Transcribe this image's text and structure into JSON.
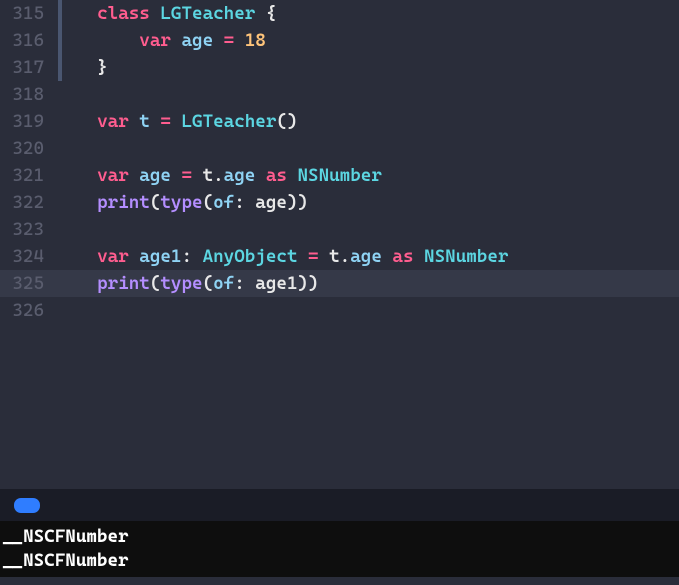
{
  "lines": [
    {
      "num": 315,
      "gutter": true,
      "highlight": false,
      "indent": "  ",
      "tokens": [
        {
          "cls": "kw",
          "t": "class"
        },
        {
          "cls": "punct",
          "t": " "
        },
        {
          "cls": "type",
          "t": "LGTeacher"
        },
        {
          "cls": "punct",
          "t": " {"
        }
      ]
    },
    {
      "num": 316,
      "gutter": true,
      "highlight": false,
      "indent": "      ",
      "tokens": [
        {
          "cls": "kw",
          "t": "var"
        },
        {
          "cls": "punct",
          "t": " "
        },
        {
          "cls": "prop",
          "t": "age"
        },
        {
          "cls": "punct",
          "t": " "
        },
        {
          "cls": "eq",
          "t": "="
        },
        {
          "cls": "punct",
          "t": " "
        },
        {
          "cls": "num",
          "t": "18"
        }
      ]
    },
    {
      "num": 317,
      "gutter": true,
      "highlight": false,
      "indent": "  ",
      "tokens": [
        {
          "cls": "punct",
          "t": "}"
        }
      ]
    },
    {
      "num": 318,
      "gutter": false,
      "highlight": false,
      "indent": "",
      "tokens": []
    },
    {
      "num": 319,
      "gutter": false,
      "highlight": false,
      "indent": "  ",
      "tokens": [
        {
          "cls": "kw",
          "t": "var"
        },
        {
          "cls": "punct",
          "t": " "
        },
        {
          "cls": "prop",
          "t": "t"
        },
        {
          "cls": "punct",
          "t": " "
        },
        {
          "cls": "eq",
          "t": "="
        },
        {
          "cls": "punct",
          "t": " "
        },
        {
          "cls": "type",
          "t": "LGTeacher"
        },
        {
          "cls": "punct",
          "t": "()"
        }
      ]
    },
    {
      "num": 320,
      "gutter": false,
      "highlight": false,
      "indent": "",
      "tokens": []
    },
    {
      "num": 321,
      "gutter": false,
      "highlight": false,
      "indent": "  ",
      "tokens": [
        {
          "cls": "kw",
          "t": "var"
        },
        {
          "cls": "punct",
          "t": " "
        },
        {
          "cls": "prop",
          "t": "age"
        },
        {
          "cls": "punct",
          "t": " "
        },
        {
          "cls": "eq",
          "t": "="
        },
        {
          "cls": "punct",
          "t": " "
        },
        {
          "cls": "var",
          "t": "t"
        },
        {
          "cls": "punct",
          "t": "."
        },
        {
          "cls": "prop",
          "t": "age"
        },
        {
          "cls": "punct",
          "t": " "
        },
        {
          "cls": "kw",
          "t": "as"
        },
        {
          "cls": "punct",
          "t": " "
        },
        {
          "cls": "type",
          "t": "NSNumber"
        }
      ]
    },
    {
      "num": 322,
      "gutter": false,
      "highlight": false,
      "indent": "  ",
      "tokens": [
        {
          "cls": "fn",
          "t": "print"
        },
        {
          "cls": "punct",
          "t": "("
        },
        {
          "cls": "fn",
          "t": "type"
        },
        {
          "cls": "punct",
          "t": "("
        },
        {
          "cls": "param",
          "t": "of"
        },
        {
          "cls": "punct",
          "t": ": "
        },
        {
          "cls": "var",
          "t": "age"
        },
        {
          "cls": "punct",
          "t": "))"
        }
      ]
    },
    {
      "num": 323,
      "gutter": false,
      "highlight": false,
      "indent": "",
      "tokens": []
    },
    {
      "num": 324,
      "gutter": false,
      "highlight": false,
      "indent": "  ",
      "tokens": [
        {
          "cls": "kw",
          "t": "var"
        },
        {
          "cls": "punct",
          "t": " "
        },
        {
          "cls": "prop",
          "t": "age1"
        },
        {
          "cls": "punct",
          "t": ": "
        },
        {
          "cls": "type",
          "t": "AnyObject"
        },
        {
          "cls": "punct",
          "t": " "
        },
        {
          "cls": "eq",
          "t": "="
        },
        {
          "cls": "punct",
          "t": " "
        },
        {
          "cls": "var",
          "t": "t"
        },
        {
          "cls": "punct",
          "t": "."
        },
        {
          "cls": "prop",
          "t": "age"
        },
        {
          "cls": "punct",
          "t": " "
        },
        {
          "cls": "kw",
          "t": "as"
        },
        {
          "cls": "punct",
          "t": " "
        },
        {
          "cls": "type",
          "t": "NSNumber"
        }
      ]
    },
    {
      "num": 325,
      "gutter": false,
      "highlight": true,
      "indent": "  ",
      "tokens": [
        {
          "cls": "fn",
          "t": "print"
        },
        {
          "cls": "punct",
          "t": "("
        },
        {
          "cls": "fn",
          "t": "type"
        },
        {
          "cls": "punct",
          "t": "("
        },
        {
          "cls": "param",
          "t": "of"
        },
        {
          "cls": "punct",
          "t": ": "
        },
        {
          "cls": "var",
          "t": "age1"
        },
        {
          "cls": "punct",
          "t": "))"
        }
      ]
    },
    {
      "num": 326,
      "gutter": false,
      "highlight": false,
      "indent": "",
      "tokens": []
    }
  ],
  "console": {
    "output": [
      "__NSCFNumber",
      "__NSCFNumber"
    ]
  }
}
